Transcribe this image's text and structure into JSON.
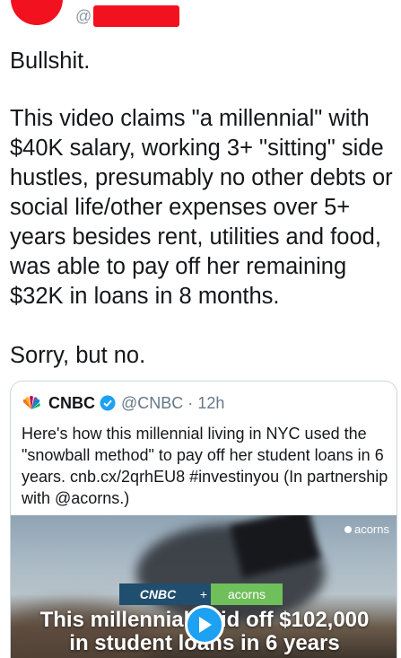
{
  "tweet": {
    "handle": "@",
    "paragraphs": [
      "Bullshit.",
      "This video claims \"a millennial\" with $40K salary, working 3+ \"sitting\" side hustles, presumably no other debts or social life/other expenses over 5+ years besides rent, utilities and food, was able to pay off her remaining $32K in loans in 8 months.",
      "Sorry, but no."
    ]
  },
  "quoted_tweet": {
    "name": "CNBC",
    "handle": "@CNBC",
    "separator": "·",
    "time": "12h",
    "text": "Here's how this millennial living in NYC used the \"snowball method\" to pay off her student loans in 6 years. cnb.cx/2qrhEU8 #investinyou (In partnership with @acorns.)",
    "media": {
      "watermark": "acorns",
      "brand_cnbc": "CNBC",
      "brand_plus": "+",
      "brand_acorns": "acorns",
      "caption_line1": "This millennial paid off $102,000",
      "caption_line2": "in student loans in 6 years"
    }
  },
  "colors": {
    "redaction": "#f2111f",
    "text": "#14171a",
    "muted": "#657786",
    "border": "#ccd6dd",
    "play_button": "#1da1f2",
    "verified": "#1da1f2"
  },
  "icons": [
    "peacock-icon",
    "verified-icon",
    "play-icon",
    "acorn-icon"
  ]
}
